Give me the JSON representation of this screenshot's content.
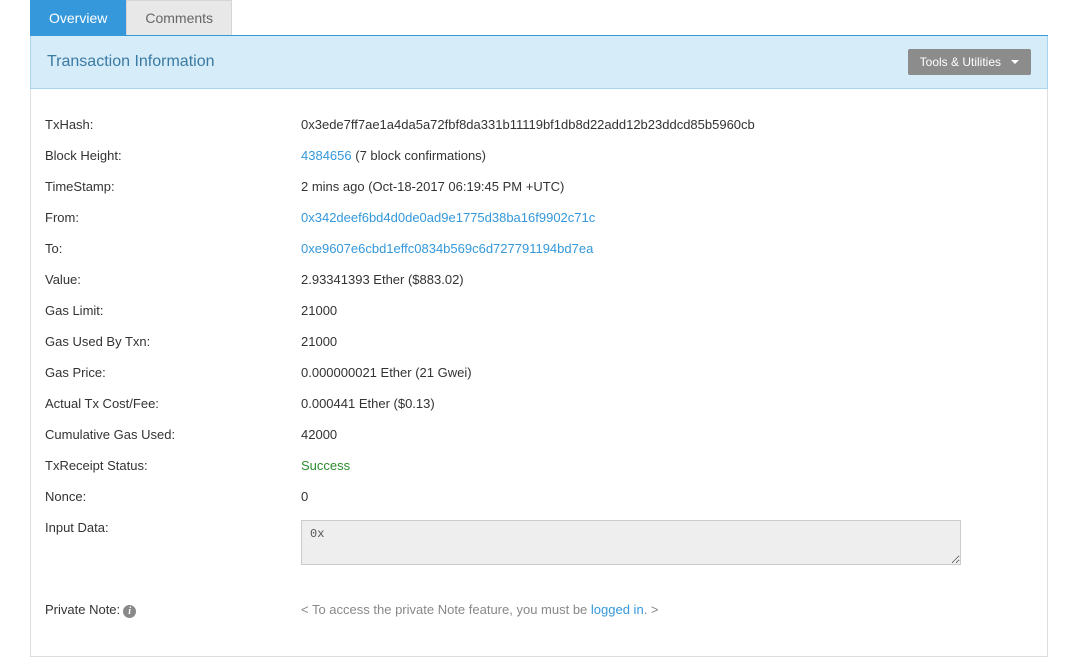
{
  "tabs": {
    "overview": "Overview",
    "comments": "Comments"
  },
  "panel": {
    "title": "Transaction Information",
    "tools_button": "Tools & Utilities"
  },
  "fields": {
    "txhash": {
      "label": "TxHash:",
      "value": "0x3ede7ff7ae1a4da5a72fbf8da331b11119bf1db8d22add12b23ddcd85b5960cb"
    },
    "block_height": {
      "label": "Block Height:",
      "link": "4384656",
      "suffix": " (7 block confirmations)"
    },
    "timestamp": {
      "label": "TimeStamp:",
      "value": "2 mins ago (Oct-18-2017 06:19:45 PM +UTC)"
    },
    "from": {
      "label": "From:",
      "link": "0x342deef6bd4d0de0ad9e1775d38ba16f9902c71c"
    },
    "to": {
      "label": "To:",
      "link": "0xe9607e6cbd1effc0834b569c6d727791194bd7ea"
    },
    "value": {
      "label": "Value:",
      "value": "2.93341393 Ether ($883.02)"
    },
    "gas_limit": {
      "label": "Gas Limit:",
      "value": "21000"
    },
    "gas_used": {
      "label": "Gas Used By Txn:",
      "value": "21000"
    },
    "gas_price": {
      "label": "Gas Price:",
      "value": "0.000000021 Ether (21 Gwei)"
    },
    "actual_cost": {
      "label": "Actual Tx Cost/Fee:",
      "value": "0.000441 Ether ($0.13)"
    },
    "cumulative_gas": {
      "label": "Cumulative Gas Used:",
      "value": "42000"
    },
    "receipt_status": {
      "label": "TxReceipt Status:",
      "value": "Success"
    },
    "nonce": {
      "label": "Nonce:",
      "value": "0"
    },
    "input_data": {
      "label": "Input Data:",
      "value": "0x"
    },
    "private_note": {
      "label": "Private Note:",
      "prefix": "< To access the private Note feature, you must be ",
      "link": "logged in",
      "suffix": ". >"
    }
  }
}
